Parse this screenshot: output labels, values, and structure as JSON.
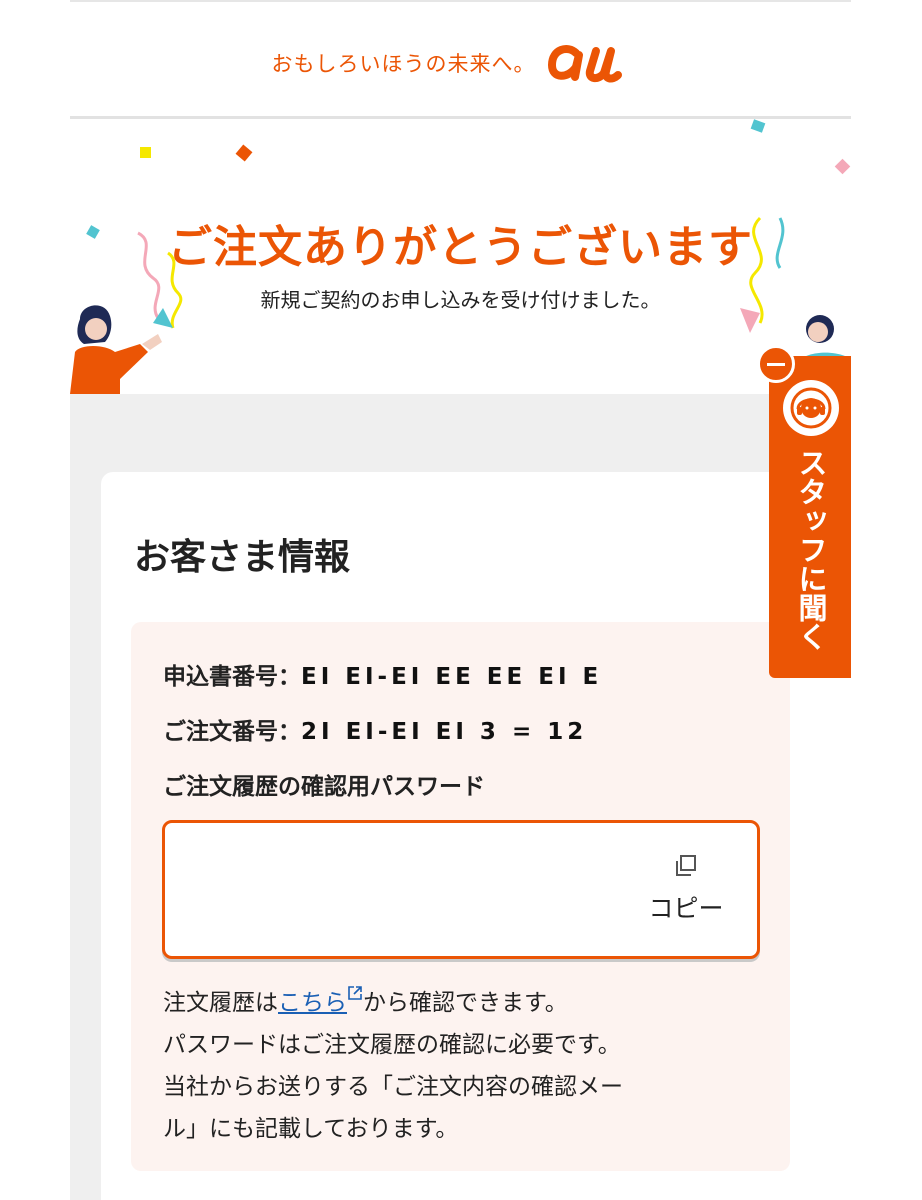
{
  "header": {
    "tagline": "おもしろいほうの未来へ。",
    "logo_text": "au"
  },
  "hero": {
    "title": "ご注文ありがとうございます",
    "subtitle": "新規ご契約のお申し込みを受け付けました。"
  },
  "customer_info": {
    "section_title": "お客さま情報",
    "application_number_label": "申込書番号：",
    "application_number_value": "EI EI-EI EE EE EI E",
    "order_number_label": "ご注文番号：",
    "order_number_value": "2I EI-EI EI 3 = 12",
    "password_label": "ご注文履歴の確認用パスワード",
    "password_value": "",
    "copy_label": "コピー"
  },
  "notes": {
    "line1_before": "注文履歴は",
    "line1_link": "こちら",
    "line1_after": "から確認できます。",
    "line2": "パスワードはご注文履歴の確認に必要です。",
    "line3": "当社からお送りする「ご注文内容の確認メー",
    "line4": "ル」にも記載しております。"
  },
  "staff_button": {
    "label": "スタッフに聞く"
  },
  "colors": {
    "brand_orange": "#eb5505",
    "link_blue": "#1a5fb4",
    "info_box_bg": "#fdf3f0"
  }
}
